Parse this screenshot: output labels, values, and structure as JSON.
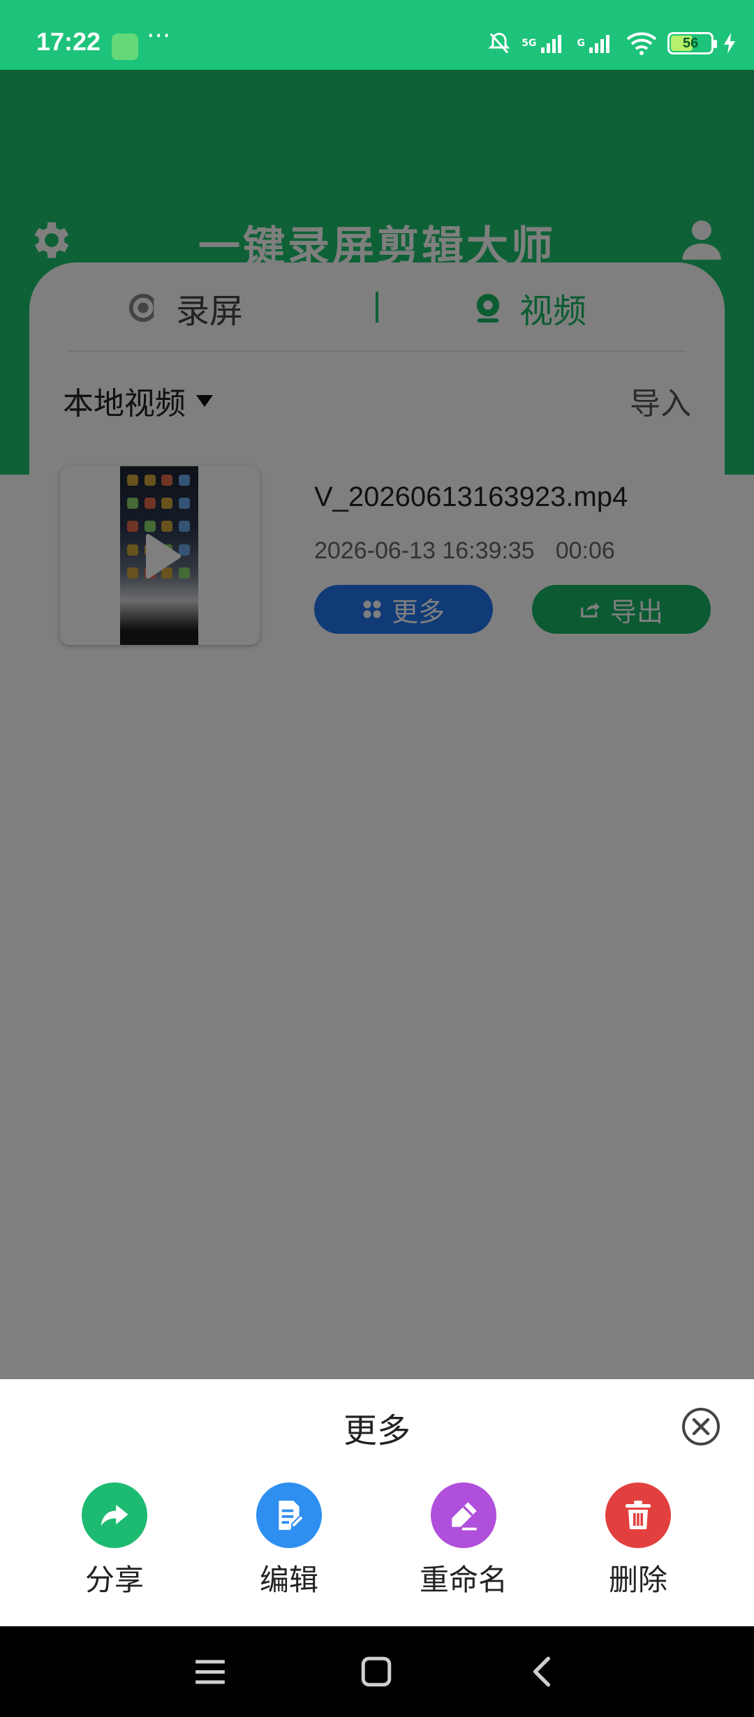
{
  "status_bar": {
    "time": "17:22",
    "dots": "···",
    "network_1": "5G",
    "network_2": "G",
    "battery_level": 56,
    "battery_text": "56",
    "icons": [
      "notification-muted-icon",
      "signal-icon",
      "signal-icon",
      "wifi-icon",
      "battery-icon",
      "charging-icon"
    ]
  },
  "header": {
    "title": "一键录屏剪辑大师",
    "left_icon": "gear-icon",
    "right_icon": "user-icon"
  },
  "tabs": [
    {
      "label": "录屏",
      "icon": "record-icon",
      "active": false
    },
    {
      "label": "视频",
      "icon": "camera-icon",
      "active": true
    }
  ],
  "filter": {
    "selected": "本地视频",
    "import_label": "导入"
  },
  "videos": [
    {
      "name": "V_20260613163923.mp4",
      "date": "2026-06-13 16:39:35",
      "duration": "00:06",
      "more_label": "更多",
      "export_label": "导出"
    }
  ],
  "sheet": {
    "title": "更多",
    "actions": [
      {
        "label": "分享",
        "icon": "share-icon",
        "color": "#1dbb72"
      },
      {
        "label": "编辑",
        "icon": "edit-document-icon",
        "color": "#2e8ff0"
      },
      {
        "label": "重命名",
        "icon": "rename-pencil-icon",
        "color": "#b04fdc"
      },
      {
        "label": "删除",
        "icon": "trash-icon",
        "color": "#e2403f"
      }
    ]
  },
  "colors": {
    "brand_green": "#1cc36d",
    "more_blue": "#2077ef",
    "export_green": "#16b565"
  }
}
